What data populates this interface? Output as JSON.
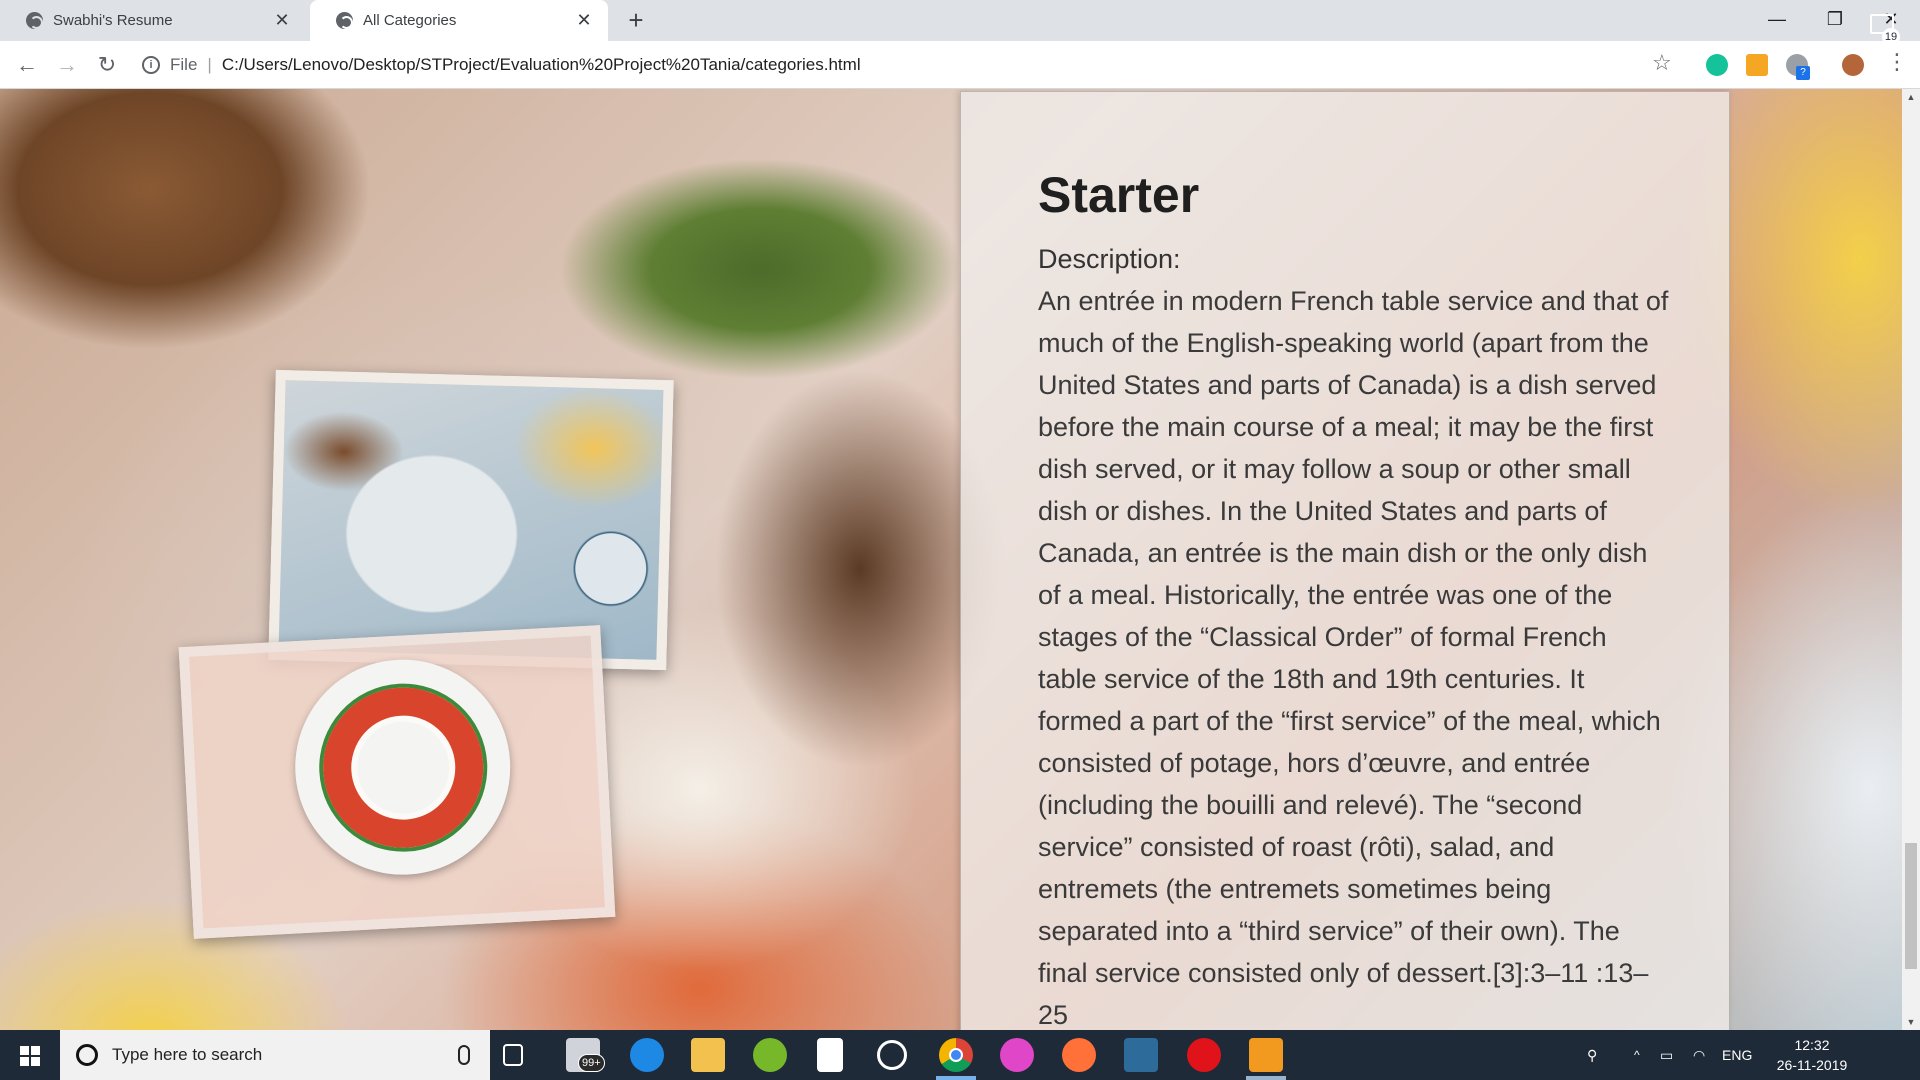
{
  "browser": {
    "tabs": [
      {
        "title": "Swabhi's Resume",
        "active": false
      },
      {
        "title": "All Categories",
        "active": true
      }
    ],
    "new_tab_glyph": "+",
    "window_controls": {
      "minimize": "—",
      "maximize": "❐",
      "close": "✕"
    },
    "address_bar": {
      "info_glyph": "i",
      "scheme_label": "File",
      "url": "C:/Users/Lenovo/Desktop/STProject/Evaluation%20Project%20Tania/categories.html"
    },
    "nav_glyphs": {
      "back": "←",
      "forward": "→",
      "reload": "↻"
    },
    "star_glyph": "☆",
    "menu_glyph": "⋮",
    "extension_badge": "?"
  },
  "page": {
    "heading": "Starter",
    "description_label": "Description:",
    "description_text": "An entrée in modern French table service and that of much of the English-speaking world (apart from the United States and parts of Canada) is a dish served before the main course of a meal; it may be the first dish served, or it may follow a soup or other small dish or dishes. In the United States and parts of Canada, an entrée is the main dish or the only dish of a meal. Historically, the entrée was one of the stages of the “Classical Order” of formal French table service of the 18th and 19th centuries. It formed a part of the “first service” of the meal, which consisted of potage, hors d’œuvre, and entrée (including the bouilli and relevé). The “second service” consisted of roast (rôti), salad, and entremets (the entremets sometimes being separated into a “third service” of their own). The final service consisted only of dessert.[3]:3–11 :13–25"
  },
  "scrollbar": {
    "up_glyph": "▲",
    "down_glyph": "▼"
  },
  "taskbar": {
    "search_placeholder": "Type here to search",
    "mail_badge": "99+",
    "tray": {
      "language": "ENG",
      "time": "12:32",
      "date": "26-11-2019",
      "notification_count": "19"
    }
  },
  "colors": {
    "chrome_tab_strip": "#dee1e6",
    "taskbar": "#1f2a38",
    "grammarly": "#15c39a",
    "edge": "#1e88e5",
    "folder": "#f2c14e",
    "utorrent": "#76b82a",
    "chrome_red": "#db4437",
    "itunes": "#e046c8",
    "firefox": "#ff7139",
    "opera": "#e0131b",
    "sublime": "#f29a1f"
  },
  "icons": {
    "taskbar_apps": [
      "task-view-icon",
      "mail-icon",
      "edge-icon",
      "file-explorer-icon",
      "utorrent-icon",
      "document-icon",
      "groove-music-icon",
      "chrome-icon",
      "itunes-icon",
      "firefox-icon",
      "photo-app-icon",
      "opera-icon",
      "sublime-text-icon"
    ]
  }
}
